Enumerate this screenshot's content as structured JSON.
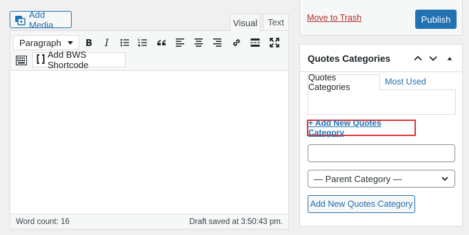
{
  "editor": {
    "add_media_label": "Add Media",
    "tabs": [
      {
        "label": "Visual"
      },
      {
        "label": "Text"
      }
    ],
    "toolbar": {
      "format_value": "Paragraph",
      "buttons": [
        "bold-icon",
        "italic-icon",
        "bullet-list-icon",
        "numbered-list-icon",
        "blockquote-icon",
        "align-left-icon",
        "align-center-icon",
        "align-right-icon",
        "link-icon",
        "read-more-icon",
        "fullscreen-icon"
      ],
      "shortcode_label": "Add BWS Shortcode"
    },
    "word_count": "Word count: 16",
    "draft_status": "Draft saved at 3:50:43 pm."
  },
  "publish": {
    "trash_label": "Move to Trash",
    "publish_label": "Publish"
  },
  "quotes_categories": {
    "title": "Quotes Categories",
    "tabs": [
      {
        "label": "Quotes Categories"
      },
      {
        "label": "Most Used"
      }
    ],
    "add_new_link": "+ Add New Quotes Category",
    "new_category_value": "",
    "parent_select_value": "— Parent Category —",
    "add_button_label": "Add New Quotes Category"
  },
  "colors": {
    "accent": "#2271b1",
    "danger": "#b32d2e",
    "highlight": "#e03232"
  }
}
